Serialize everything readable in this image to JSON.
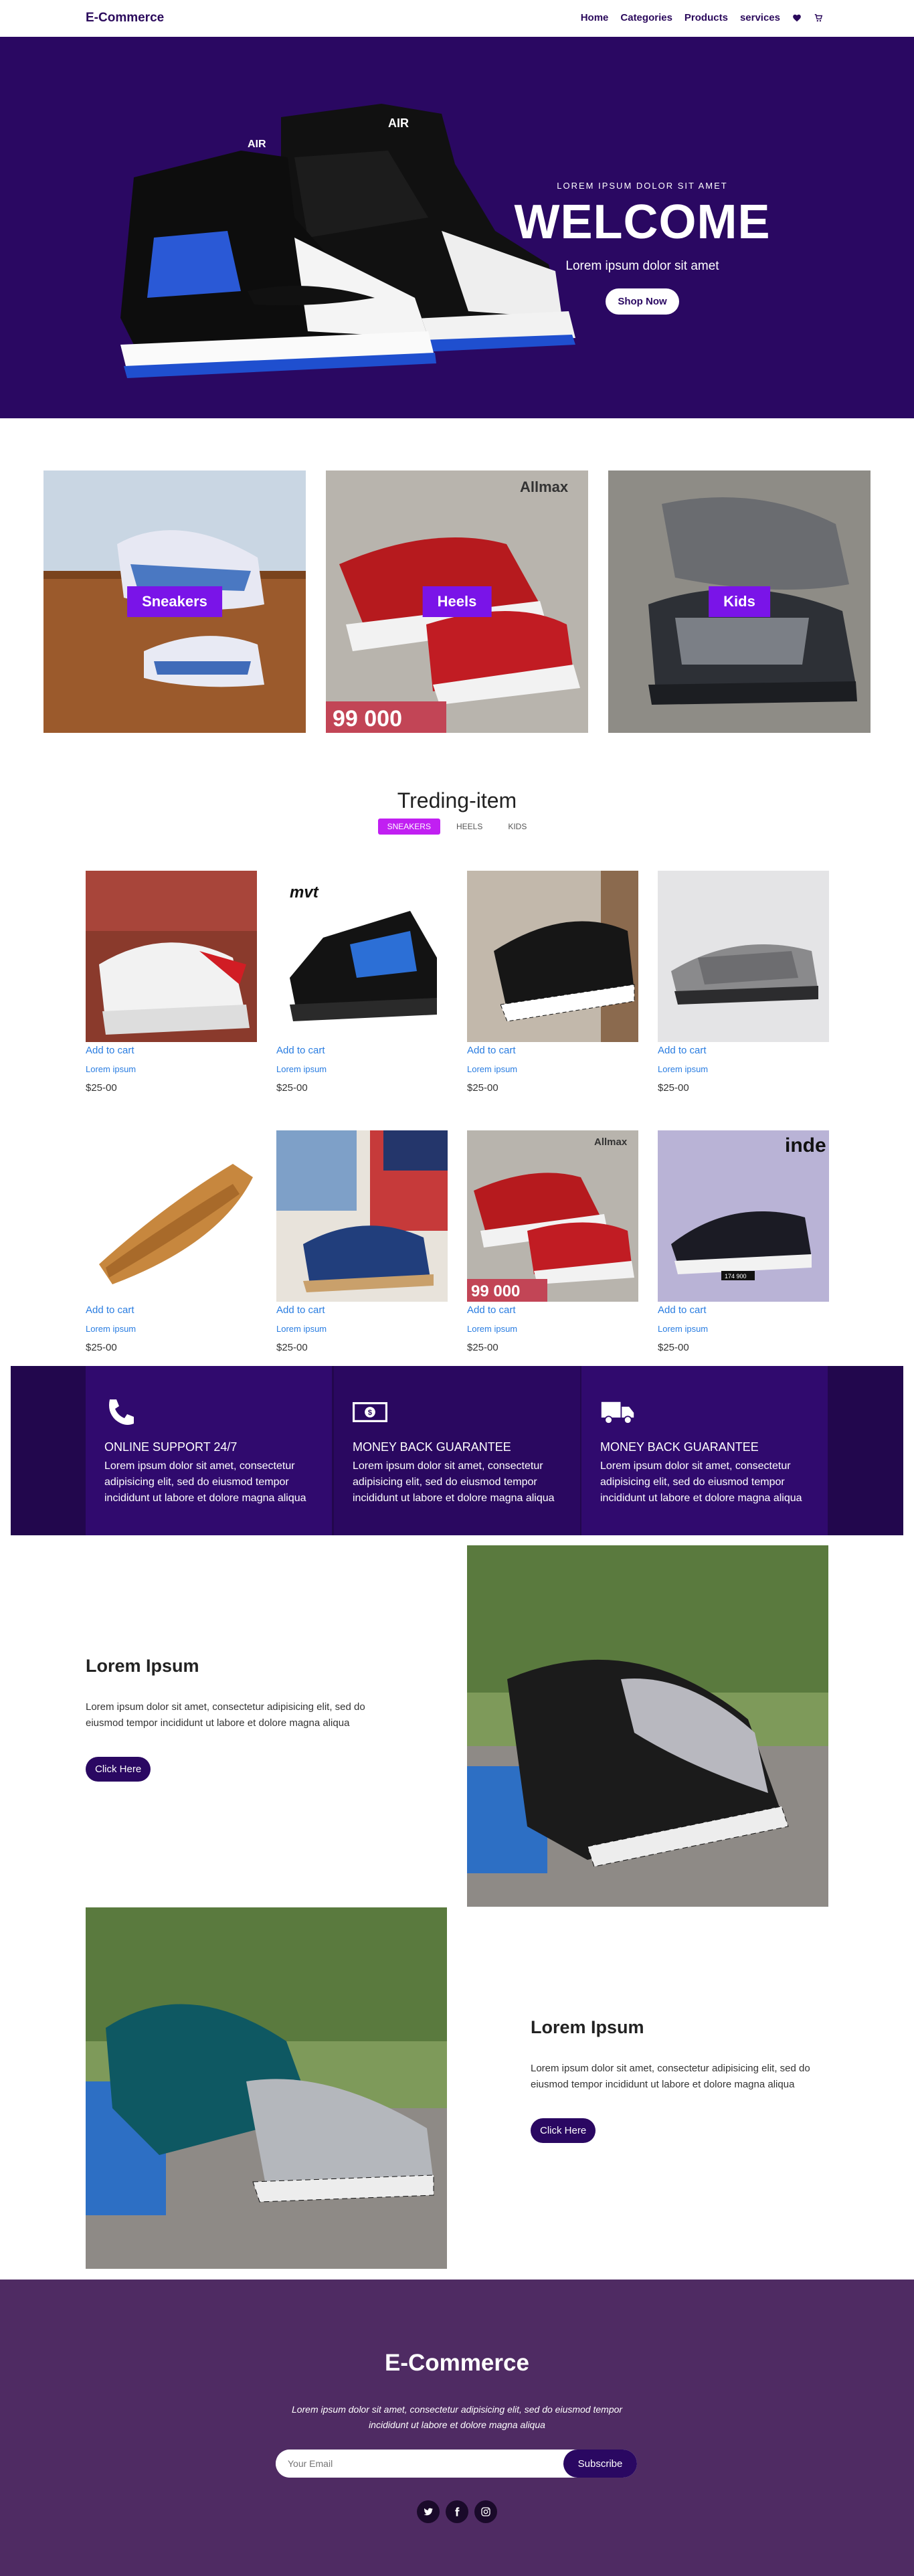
{
  "brand": "E-Commerce",
  "nav": {
    "items": [
      "Home",
      "Categories",
      "Products",
      "services"
    ]
  },
  "hero": {
    "small": "LOREM IPSUM DOLOR SIT AMET",
    "title": "WELCOME",
    "subtitle": "Lorem ipsum dolor sit amet",
    "button": "Shop Now",
    "shoe_text": "AIR"
  },
  "categories": [
    {
      "label": "Sneakers",
      "overlay": ""
    },
    {
      "label": "Heels",
      "overlay": "99 000",
      "badge": "Allmax"
    },
    {
      "label": "Kids",
      "overlay": ""
    }
  ],
  "trending": {
    "title": "Treding-item",
    "tabs": [
      "SNEAKERS",
      "HEELS",
      "KIDS"
    ],
    "active_tab": "SNEAKERS",
    "products": [
      {
        "cart": "Add to cart",
        "name": "Lorem ipsum",
        "price": "$25-00"
      },
      {
        "cart": "Add to cart",
        "name": "Lorem ipsum",
        "price": "$25-00",
        "logo": "mvt"
      },
      {
        "cart": "Add to cart",
        "name": "Lorem ipsum",
        "price": "$25-00"
      },
      {
        "cart": "Add to cart",
        "name": "Lorem ipsum",
        "price": "$25-00"
      },
      {
        "cart": "Add to cart",
        "name": "Lorem ipsum",
        "price": "$25-00"
      },
      {
        "cart": "Add to cart",
        "name": "Lorem ipsum",
        "price": "$25-00"
      },
      {
        "cart": "Add to cart",
        "name": "Lorem ipsum",
        "price": "$25-00",
        "badge": "Allmax",
        "overlay": "99 000"
      },
      {
        "cart": "Add to cart",
        "name": "Lorem ipsum",
        "price": "$25-00",
        "logo": "inde",
        "tag": "174 900"
      }
    ]
  },
  "features": [
    {
      "title": "ONLINE SUPPORT 24/7",
      "text": "Lorem ipsum dolor sit amet, consectetur adipisicing elit, sed do eiusmod tempor incididunt ut labore et dolore magna aliqua",
      "icon": "phone-icon"
    },
    {
      "title": "MONEY BACK GUARANTEE",
      "text": "Lorem ipsum dolor sit amet, consectetur adipisicing elit, sed do eiusmod tempor incididunt ut labore et dolore magna aliqua",
      "icon": "money-icon"
    },
    {
      "title": "MONEY BACK GUARANTEE",
      "text": "Lorem ipsum dolor sit amet, consectetur adipisicing elit, sed do eiusmod tempor incididunt ut labore et dolore magna aliqua",
      "icon": "truck-icon"
    }
  ],
  "about": [
    {
      "title": "Lorem Ipsum",
      "text": "Lorem ipsum dolor sit amet, consectetur adipisicing elit, sed do eiusmod tempor incididunt ut labore et dolore magna aliqua",
      "button": "Click Here"
    },
    {
      "title": "Lorem Ipsum",
      "text": "Lorem ipsum dolor sit amet, consectetur adipisicing elit, sed do eiusmod tempor incididunt ut labore et dolore magna aliqua",
      "button": "Click Here"
    }
  ],
  "footer": {
    "title": "E-Commerce",
    "text": "Lorem ipsum dolor sit amet, consectetur adipisicing elit, sed do eiusmod tempor incididunt ut labore et dolore magna aliqua",
    "email_placeholder": "Your Email",
    "subscribe": "Subscribe",
    "socials": [
      "twitter-icon",
      "facebook-icon",
      "instagram-icon"
    ]
  },
  "colors": {
    "primary": "#2a0862",
    "accent": "#7a14e8",
    "tab_active": "#c11ff2",
    "link": "#2a7de1",
    "footer": "#4f2b63"
  }
}
